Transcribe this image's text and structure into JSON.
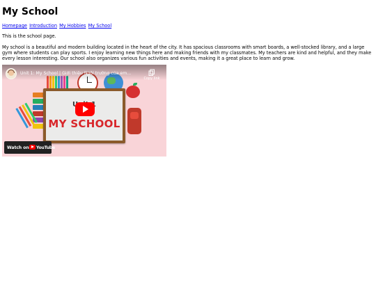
{
  "page": {
    "heading": "My School",
    "nav": [
      {
        "label": "Homepage"
      },
      {
        "label": "Introduction"
      },
      {
        "label": "My Hobbies"
      },
      {
        "label": "My School"
      }
    ],
    "intro": "This is the school page.",
    "body": "My school is a beautiful and modern building located in the heart of the city. It has spacious classrooms with smart boards, a well-stocked library, and a large gym where students can play sports. I enjoy learning new things here and making friends with my classmates. My teachers are kind and helpful, and they make every lesson interesting. Our school also organizes various fun activities and events, making it a great place to learn and grow."
  },
  "video": {
    "title": "Unit 1: My School | Giới thiệu Ngôi trường của em...",
    "copy_label": "Copy link",
    "thumb_unit": "Unit 1",
    "thumb_title": "MY SCHOOL",
    "watch_on": "Watch on",
    "youtube_word": "YouTube",
    "icons": {
      "channel": "channel-avatar-icon",
      "copy": "copy-link-icon",
      "play": "play-icon",
      "youtube": "youtube-logo-icon"
    }
  }
}
